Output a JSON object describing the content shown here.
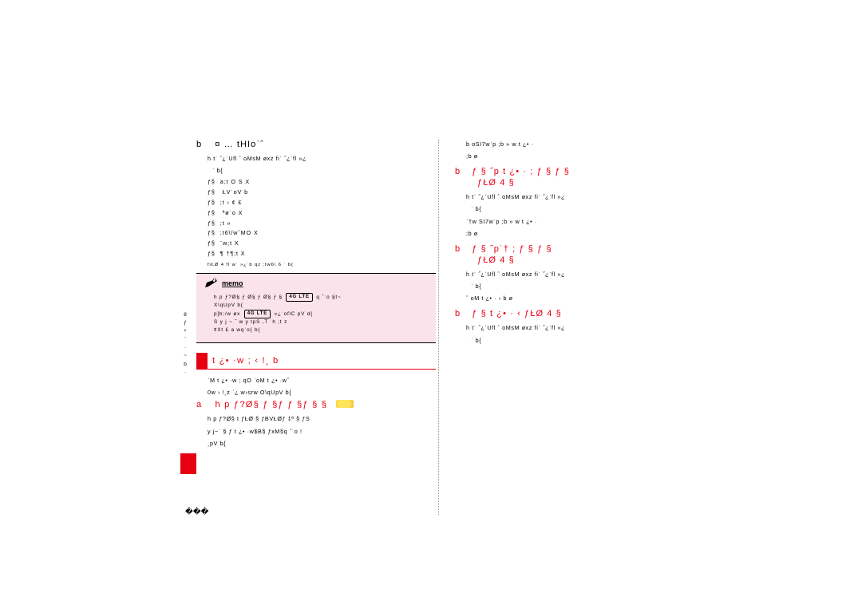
{
  "sidebar": {
    "l1": "8",
    "l2": "ƒ",
    "l3": "º",
    "l4": "¨",
    "l5": "·",
    "l6": "~",
    "l7": "b",
    "l8": "·"
  },
  "left": {
    "step_b_n": "b",
    "step_b": "¤ … tHIoˈˆ",
    "body1": "h tˈ ˝¿ˈUfl ˆ oMsM øxz    fiˈ ˝¿ˈfl   »¿",
    "body2": "ˈ b{",
    "li1": "a;t  O S X",
    "li2": "  ŁVˈoV b",
    "li3": ";t  ›   ¢   £",
    "li4": " ªøˈo X",
    "li5": ";t »",
    "li6": ";t6\\/wˆMO  X",
    "li7": "¨w;t  X",
    "li8": "¶ †¶;t  X",
    "small": "fiŁØ 4 fl    wˈ »¿ˈb qz     ;tw6\\ 6 ˈ b{",
    "memo_label": "memo",
    "memo1": "h p  ƒ?Ø§ ƒ Ø§ ƒ Ø§ ƒ §",
    "memo_badge1": "4G LTE",
    "memo1b": "q ˆˈo §t~",
    "memo2": "   X\\qUpV b{",
    "memo3": "   p]b;/w øx",
    "memo_badge2": "4G LTE",
    "memo3b": "»¿ˈoflC pV d{",
    "memo4": "   S y  j ~ ˝  w y  tpS ,T ˈh ;t z",
    "memo5": "   ¢Xt   £  a wqˈo{  b{",
    "sec_title": "t ¿• ·w ; ‹  !¸ b",
    "intro1": "ˈM t ¿• ·w ; qO ˈoM  t ¿• ·w˝",
    "intro2": "0w ›  !¸z    ˈ¿  w›srw    O\\qUpV b{",
    "red_n": "a",
    "red_step": "h  p   ƒ?Ø§ ƒ  §ƒ  ƒ §ƒ §         §",
    "red_body1": "h p  ƒ?Ø§ t    ƒŁØ  §   ƒBVŁØƒ ‡ª §  ƒS",
    "red_body2": "y j~ˈ §    ƒ t ¿• ·w$B§    ƒxM§q ˆˈo !",
    "red_body3": "¸pV b{"
  },
  "right": {
    "top1": "b oSI7wˈp ;b » w t ¿• ·",
    "top2": ";b  ø",
    "h1_n": "b",
    "h1": "ƒ §    ˝p t ¿• ·  ;       ƒ  §  ƒ §",
    "h1b": "ƒŁØ 4 §",
    "b1": "h tˈ ˝¿ˈUfl ˆ oMsM øxz    fiˈ ˝¿ˈfl   »¿",
    "b1b": "ˈ b{",
    "b2": "ˈ†w SI7wˈp ;b » w t ¿• ·",
    "b2b": ";b  ø",
    "h2_n": "b",
    "h2": "ƒ §    ˝pˈ†   ;        ƒ  §  ƒ §",
    "h2b": "ƒŁØ 4 §",
    "b3": "h tˈ ˝¿ˈUfl ˆ oMsM øxz    fiˈ ˝¿ˈfl   »¿",
    "b3b": "ˈ b{",
    "b4": "ˆ oM  t ¿• · ‹ b  ø",
    "h3_n": "b",
    "h3": "ƒ §   t ¿• · ‹        ƒŁØ 4 §",
    "b5": "h tˈ ˝¿ˈUfl ˆ oMsM øxz    fiˈ ˝¿ˈfl   »¿",
    "b5b": "ˈ b{"
  },
  "page_no": "���"
}
